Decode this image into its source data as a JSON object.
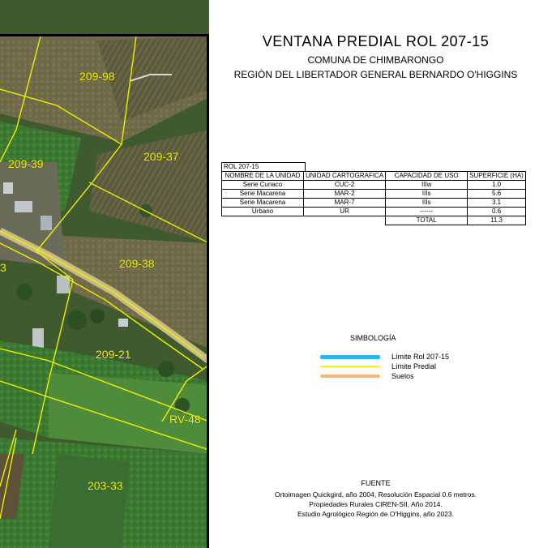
{
  "header": {
    "title": "VENTANA PREDIAL  ROL 207-15",
    "subtitle": "COMUNA DE CHIMBARONGO",
    "region": "REGIÓN DEL LIBERTADOR GENERAL BERNARDO O'HIGGINS"
  },
  "table": {
    "rol": "ROL 207-15",
    "headers": [
      "NOMBRE DE LA UNIDAD",
      "UNIDAD CARTOGRAFICA",
      "CAPACIDAD DE USO",
      "SUPERFICIE (HA)"
    ],
    "rows": [
      [
        "Serie Cunaco",
        "CUC-2",
        "IIIw",
        "1.0"
      ],
      [
        "Serie Macarena",
        "MAR-2",
        "IIIs",
        "5.6"
      ],
      [
        "Serie Macarena",
        "MAR-7",
        "IIIs",
        "3.1"
      ],
      [
        "Urbano",
        "UR",
        "------",
        "0.6"
      ]
    ],
    "total_label": "TOTAL",
    "total_value": "11.3"
  },
  "legend": {
    "title": "SIMBOLOGÍA",
    "items": [
      {
        "label": "Límite Rol 207-15",
        "color": "#29b6f6"
      },
      {
        "label": "Límite Predial",
        "color": "#f5f500"
      },
      {
        "label": "Suelos",
        "color": "#f4b97a"
      }
    ]
  },
  "source": {
    "title": "FUENTE",
    "lines": [
      "Ortoimagen Quickgird, año 2004, Resolución Espacial 0.6 metros.",
      "Propiedades Rurales CIREN-SII, Año 2014.",
      "Estudio Agrológico Región de O'Higgins, año 2023."
    ]
  },
  "map": {
    "parcel_labels": [
      "209-98",
      "209-39",
      "209-37",
      "209-38",
      "209-21",
      "RV-48",
      "203-33",
      "3"
    ]
  }
}
